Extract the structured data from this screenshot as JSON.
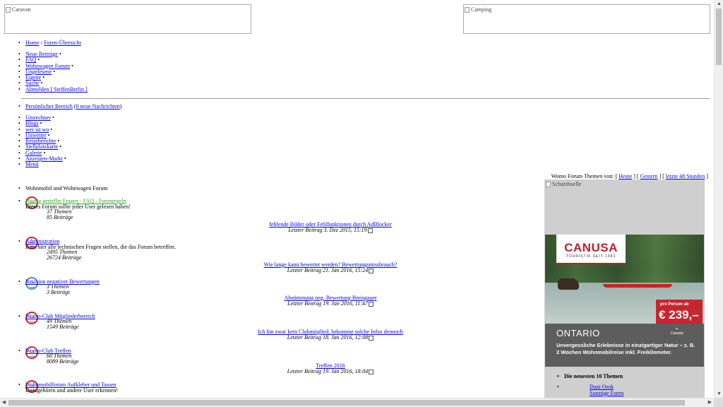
{
  "banners": {
    "left_alt": "Caravan",
    "right_alt": "Camping"
  },
  "breadcrumb": {
    "home": "Home",
    "separator": "‹",
    "forum_index": "Foren-Übersicht"
  },
  "nav_main": [
    {
      "label": "Neue Beiträge"
    },
    {
      "label": "FAQ"
    },
    {
      "label": "Wohnwagen Forum"
    },
    {
      "label": "Ungelesene"
    },
    {
      "label": "Eigene"
    },
    {
      "label": "Suche"
    },
    {
      "label": "Abmelden [ SteffenBerlin ]"
    }
  ],
  "personal": {
    "label": "Persönlicher Bereich",
    "messages_open": "(",
    "messages": "0 neue Nachrichten",
    "messages_close": ")"
  },
  "nav_tools": [
    {
      "label": "Umrechner"
    },
    {
      "label": "Blogs"
    },
    {
      "label": "wer ist wo"
    },
    {
      "label": "Unwetter"
    },
    {
      "label": "Reiseberichte"
    },
    {
      "label": "Stellplatzkarte"
    },
    {
      "label": "Galerie"
    },
    {
      "label": "Anzeigen-Markt"
    },
    {
      "label": "Menü"
    }
  ],
  "recent_topics": {
    "prefix": "Womo Forum Themen von:",
    "today": "Heute",
    "yesterday": "Gestern",
    "last48": "letzte 48 Stunden"
  },
  "category": "Wohnmobil und Wohnwagen Forum",
  "forums": [
    {
      "title": "Häufig gestellte Fragen - FAQ - Forenregeln",
      "desc": "Dieses Forum sollte jeder User gelesen haben!",
      "topics": "37 Themen",
      "posts": "85 Beiträge",
      "last_title": "fehlende Bilder oder Fehlfunktionen durch AdBlocker",
      "last_when": "Letzter Beitrag 3. Dez 2015, 15:19",
      "icon": "red",
      "green": true
    },
    {
      "title": "Administration",
      "desc": "Bitte hier alle technischen Fragen stellen, die das Forum betreffen.",
      "topics": "2495 Themen",
      "posts": "26724 Beiträge",
      "last_title": "Wie lange kann bewertet werden? Bewertungsmissbrauch?",
      "last_when": "Letzter Beitrag 21. Jan 2016, 15:24",
      "icon": "red",
      "green": false
    },
    {
      "title": "Revision negativer Bewertungen",
      "desc": "",
      "topics": "3 Themen",
      "posts": "3 Beiträge",
      "last_title": "Abstimmung neg. Bewertung Breisgauer",
      "last_when": "Letzter Beitrag 19. Jan 2016, 11:47",
      "icon": "blue",
      "green": false
    },
    {
      "title": "Womo-Club Mitgliederbereich",
      "desc": "",
      "topics": "49 Themen",
      "posts": "1549 Beiträge",
      "last_title": "Ich bin zwar kein Clubmitglied, bekomme solche Infos dennoch",
      "last_when": "Letzter Beitrag 18. Jan 2016, 12:08",
      "icon": "red",
      "green": false
    },
    {
      "title": "Womo-Club Treffen",
      "desc": "",
      "topics": "60 Themen",
      "posts": "8089 Beiträge",
      "last_title": "Treffen 2016",
      "last_when": "Letzter Beitrag 19. Jan 2016, 18:04",
      "icon": "red",
      "green": false
    },
    {
      "title": "Wohnmobilforum Aufkleber und Tassen",
      "desc": "Dazugehören und andere User erkennen!",
      "topics": "",
      "posts": "",
      "last_title": "",
      "last_when": "",
      "icon": "red",
      "green": false
    }
  ],
  "sidebar": {
    "broken_alt": "Schutzhuelle",
    "ad": {
      "brand": "CANUSA",
      "brand_sub": "TOURISTIK SEIT 1983",
      "price_prefix": "pro Person ab",
      "price": "€ 239,–",
      "region": "ONTARIO",
      "tagline": "Unvergessliche Erlebnisse in einzigartiger Natur – z. B. 2 Wochen Wohnmobilreise inkl. Freikilometer.",
      "partner": "Canada"
    },
    "list_head": "Die neuesten 10 Themen",
    "topic_title": "Dani Orok",
    "topic_forum": "Sonstige Foren"
  },
  "colors": {
    "link": "#0000ee",
    "green_link": "#2ba12b",
    "icon_red": "#d12a2a",
    "icon_blue": "#4c8ed0",
    "ad_red": "#c7252f"
  }
}
